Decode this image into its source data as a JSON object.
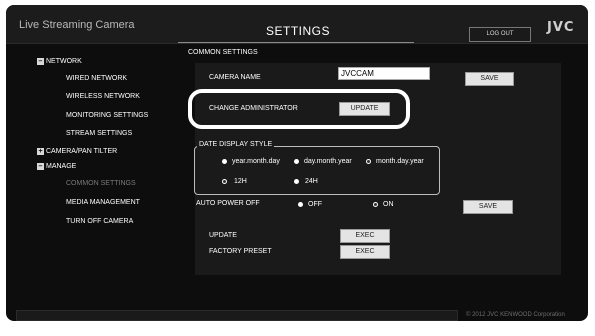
{
  "header": {
    "app_title": "Live Streaming Camera",
    "page_title": "SETTINGS",
    "logout_label": "LOG OUT",
    "brand": "JVC"
  },
  "sidebar": {
    "network": "NETWORK",
    "wired_network": "WIRED NETWORK",
    "wireless_network": "WIRELESS NETWORK",
    "monitoring_settings": "MONITORING SETTINGS",
    "stream_settings": "STREAM SETTINGS",
    "camera_pan_tilter": "CAMERA/PAN TILTER",
    "manage": "MANAGE",
    "common_settings": "COMMON SETTINGS",
    "media_management": "MEDIA MANAGEMENT",
    "turn_off_camera": "TURN OFF CAMERA"
  },
  "main": {
    "section_title": "COMMON SETTINGS",
    "camera_name_label": "CAMERA NAME",
    "camera_name_value": "JVCCAM",
    "save_label": "SAVE",
    "change_admin_label": "CHANGE ADMINISTRATOR",
    "update_button": "UPDATE",
    "date_display_label": "DATE DISPLAY STYLE",
    "date_formats": [
      "year.month.day",
      "day.month.year",
      "month.day.year"
    ],
    "time_formats": [
      "12H",
      "24H"
    ],
    "auto_power_label": "AUTO POWER OFF",
    "auto_power_off": "OFF",
    "auto_power_on": "ON",
    "save2_label": "SAVE",
    "update_label": "UPDATE",
    "factory_preset_label": "FACTORY PRESET",
    "exec_label": "EXEC",
    "exec2_label": "EXEC"
  },
  "footer": {
    "copyright": "© 2012 JVC KENWOOD Corporation"
  },
  "state": {
    "selected_date_format": "month.day.year",
    "selected_time_format": "12H",
    "auto_power_off": "ON"
  }
}
